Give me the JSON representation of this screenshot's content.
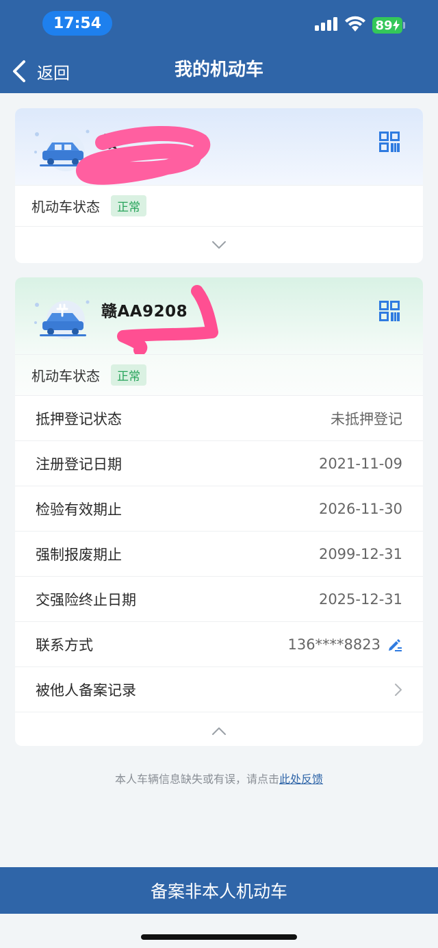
{
  "status_bar": {
    "time": "17:54",
    "battery": "89"
  },
  "header": {
    "back_label": "返回",
    "title": "我的机动车"
  },
  "vehicles": [
    {
      "plate": "赣",
      "status_label": "机动车状态",
      "status_value": "正常"
    },
    {
      "plate": "赣AA9208",
      "status_label": "机动车状态",
      "status_value": "正常",
      "details": [
        {
          "label": "抵押登记状态",
          "value": "未抵押登记"
        },
        {
          "label": "注册登记日期",
          "value": "2021-11-09"
        },
        {
          "label": "检验有效期止",
          "value": "2026-11-30"
        },
        {
          "label": "强制报废期止",
          "value": "2099-12-31"
        },
        {
          "label": "交强险终止日期",
          "value": "2025-12-31"
        },
        {
          "label": "联系方式",
          "value": "136****8823"
        },
        {
          "label": "被他人备案记录",
          "value": ""
        }
      ]
    }
  ],
  "feedback": {
    "text": "本人车辆信息缺失或有误，请点击",
    "link": "此处反馈"
  },
  "bottom_button": "备案非本人机动车",
  "colors": {
    "primary": "#2f65a8",
    "badge_bg": "#daf1e2",
    "badge_text": "#27a35a",
    "battery": "#34c759"
  }
}
